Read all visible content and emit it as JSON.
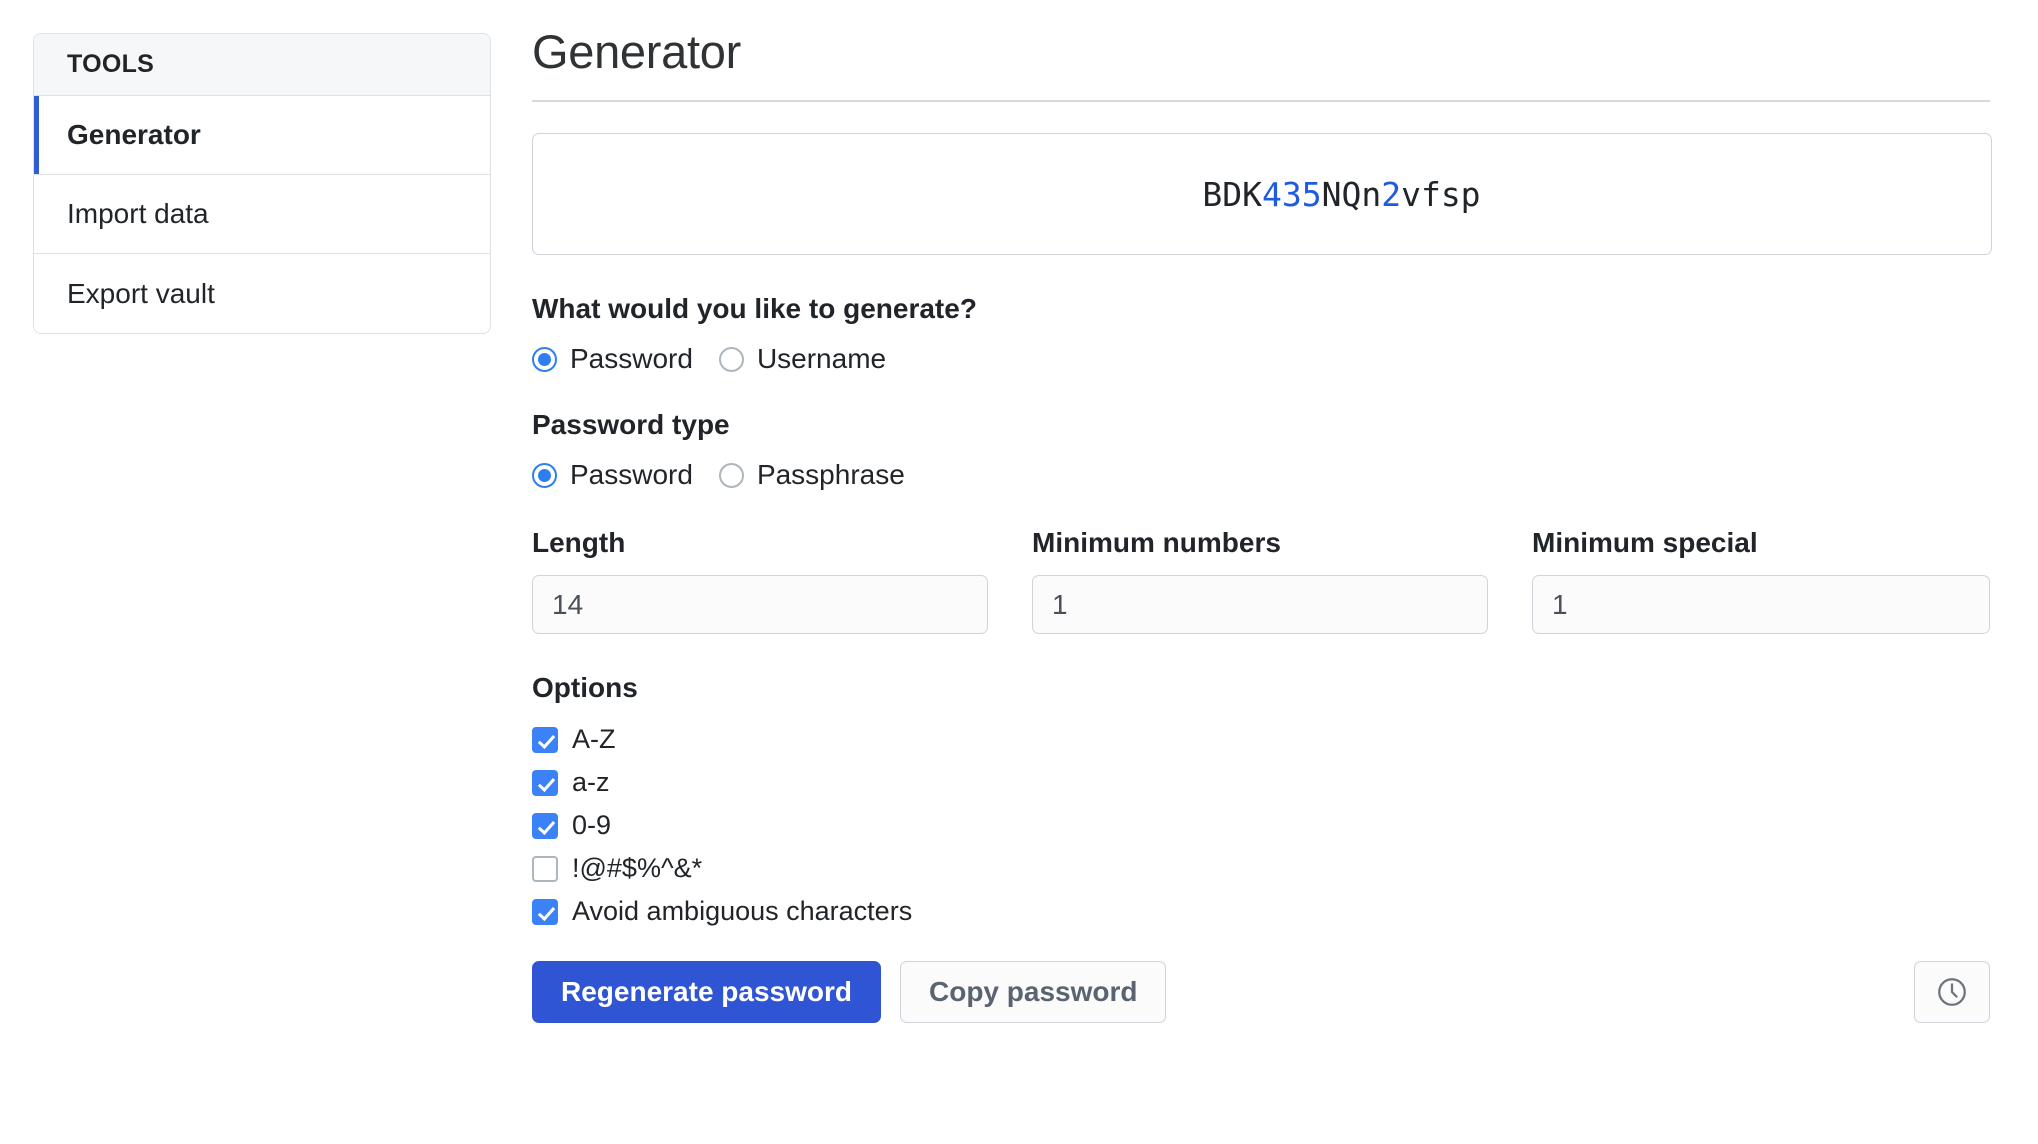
{
  "sidebar": {
    "header_title": "TOOLS",
    "items": [
      {
        "label": "Generator",
        "active": true
      },
      {
        "label": "Import data",
        "active": false
      },
      {
        "label": "Export vault",
        "active": false
      }
    ]
  },
  "main": {
    "page_title": "Generator",
    "generated_password": {
      "full": "BDK435NQn2vfsp",
      "segments": [
        {
          "text": "BDK",
          "kind": "letter"
        },
        {
          "text": "435",
          "kind": "digit"
        },
        {
          "text": "NQn",
          "kind": "letter"
        },
        {
          "text": "2",
          "kind": "digit"
        },
        {
          "text": "vfsp",
          "kind": "letter"
        }
      ]
    },
    "generate_question": {
      "label": "What would you like to generate?",
      "options": [
        {
          "label": "Password",
          "selected": true
        },
        {
          "label": "Username",
          "selected": false
        }
      ]
    },
    "password_type": {
      "label": "Password type",
      "options": [
        {
          "label": "Password",
          "selected": true
        },
        {
          "label": "Passphrase",
          "selected": false
        }
      ]
    },
    "numeric_fields": [
      {
        "label": "Length",
        "value": "14"
      },
      {
        "label": "Minimum numbers",
        "value": "1"
      },
      {
        "label": "Minimum special",
        "value": "1"
      }
    ],
    "options": {
      "label": "Options",
      "items": [
        {
          "label": "A-Z",
          "checked": true
        },
        {
          "label": "a-z",
          "checked": true
        },
        {
          "label": "0-9",
          "checked": true
        },
        {
          "label": "!@#$%^&*",
          "checked": false
        },
        {
          "label": "Avoid ambiguous characters",
          "checked": true
        }
      ]
    },
    "buttons": {
      "regenerate_label": "Regenerate password",
      "copy_label": "Copy password",
      "history_icon": "clock-icon"
    }
  },
  "colors": {
    "accent_blue": "#2f55d4",
    "digit_blue": "#1f5be0",
    "control_blue": "#3b82f6",
    "border": "#dee2e6"
  }
}
